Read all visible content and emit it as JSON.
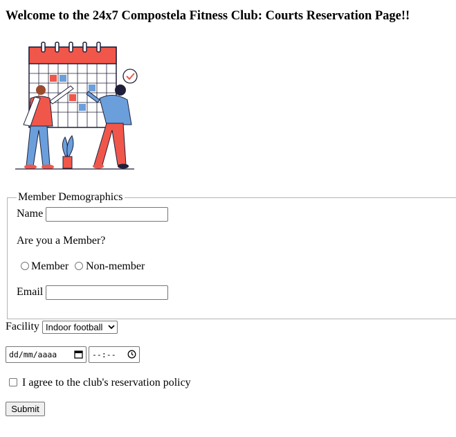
{
  "page": {
    "title": "Welcome to the 24x7 Compostela Fitness Club: Courts Reservation Page!!"
  },
  "illustration": {
    "icon": "calendar-people-illustration"
  },
  "demographics": {
    "legend": "Member Demographics",
    "name_label": "Name",
    "name_value": "",
    "member_question": "Are you a Member?",
    "member_option": "Member",
    "nonmember_option": "Non-member",
    "email_label": "Email",
    "email_value": ""
  },
  "facility": {
    "label": "Facility",
    "selected": "Indoor football"
  },
  "datetime": {
    "date_placeholder": "dd/mm/aaaa",
    "time_placeholder": "--:--"
  },
  "policy": {
    "label": "I agree to the club's reservation policy",
    "checked": false
  },
  "submit": {
    "label": "Submit"
  },
  "colors": {
    "accent": "#f0574a",
    "blue": "#6b9fdc",
    "dark": "#1f1f3a"
  }
}
